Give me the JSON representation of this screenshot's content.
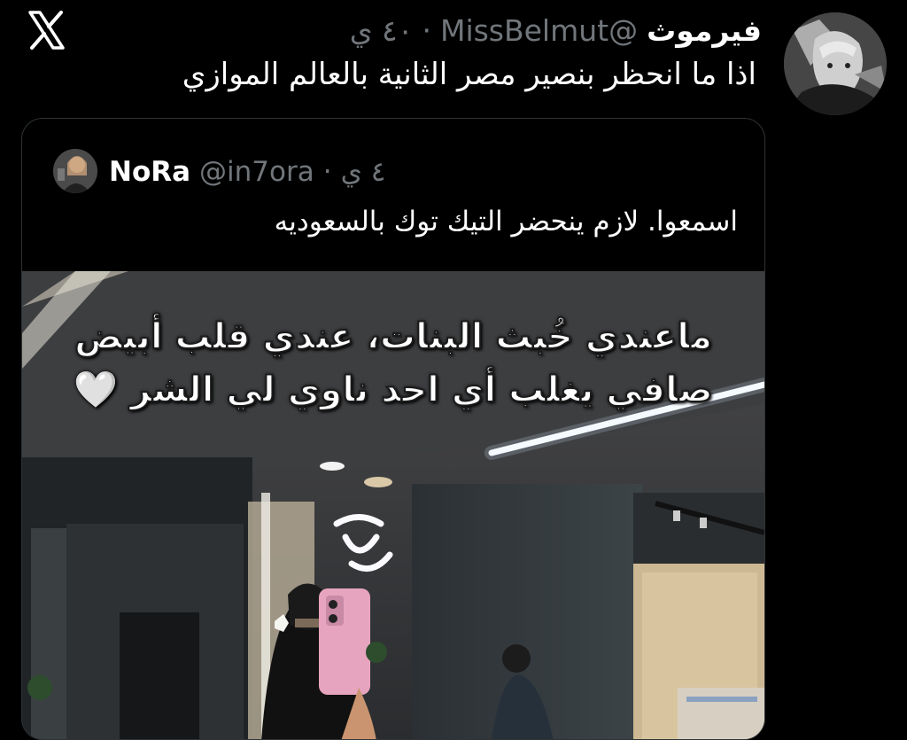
{
  "app": {
    "logo_icon": "x-logo-icon"
  },
  "post": {
    "name": "فيرموث",
    "handle": "@MissBelmut",
    "separator": "·",
    "time": "٤٠ ي",
    "text": "اذا ما انحظر بنصير مصر الثانية بالعالم الموازي",
    "avatar_icon": "anime-avatar-icon"
  },
  "quote": {
    "name": "NoRa",
    "handle": "@in7ora",
    "separator": "·",
    "time": "٤ ي",
    "text": "اسمعوا. لازم ينحضر التيك توك بالسعوديه",
    "avatar_icon": "user-avatar-icon",
    "media": {
      "overlay_line1": "ماعندي خُبث البنات، عندي قلب أبيض",
      "overlay_line2": "صافي يغلب أي احد ناوي لي الشر",
      "heart": "🤍"
    }
  }
}
